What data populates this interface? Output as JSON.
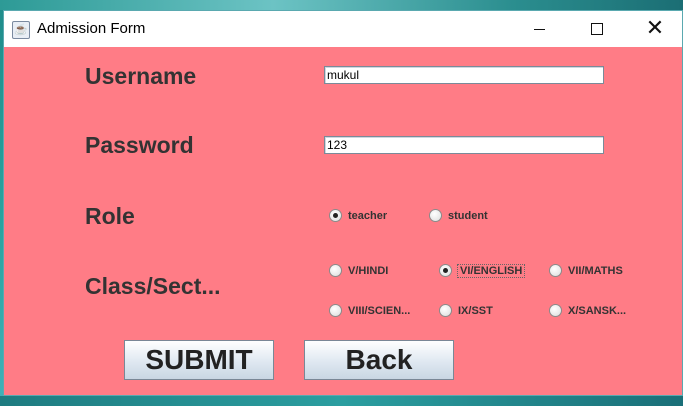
{
  "window": {
    "title": "Admission Form",
    "icon": "java-cup-icon",
    "controls": {
      "minimize": "–",
      "maximize": "□",
      "close": "✕"
    }
  },
  "form": {
    "username_label": "Username",
    "username_value": "mukul",
    "password_label": "Password",
    "password_value": "123",
    "role_label": "Role",
    "roles": [
      {
        "label": "teacher",
        "selected": true
      },
      {
        "label": "student",
        "selected": false
      }
    ],
    "class_label": "Class/Sect...",
    "classes": [
      {
        "label": "V/HINDI",
        "selected": false
      },
      {
        "label": "VI/ENGLISH",
        "selected": true
      },
      {
        "label": "VII/MATHS",
        "selected": false
      },
      {
        "label": "VIII/SCIEN...",
        "selected": false
      },
      {
        "label": "IX/SST",
        "selected": false
      },
      {
        "label": "X/SANSK...",
        "selected": false
      }
    ],
    "submit_label": "SUBMIT",
    "back_label": "Back"
  },
  "colors": {
    "form_background": "#ff7c86",
    "label_text": "#333333"
  }
}
